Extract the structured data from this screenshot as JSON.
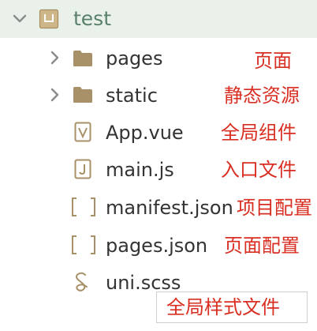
{
  "colors": {
    "header_bg": "#e9f1ea",
    "project_title": "#59806a",
    "annotation": "#d92e22",
    "icon": "#b19a6a",
    "chevron": "#8a8a8a",
    "text": "#333333"
  },
  "project": {
    "name": "test",
    "icon": "project-folder-icon",
    "expanded": true
  },
  "tree": [
    {
      "label": "pages",
      "icon": "folder-icon",
      "annotation": "页面"
    },
    {
      "label": "static",
      "icon": "folder-icon",
      "annotation": "静态资源"
    },
    {
      "label": "App.vue",
      "icon": "vue-file-icon",
      "annotation": "全局组件"
    },
    {
      "label": "main.js",
      "icon": "js-file-icon",
      "annotation": "入口文件"
    },
    {
      "label": "manifest.json",
      "icon": "json-file-icon",
      "annotation": "项目配置"
    },
    {
      "label": "pages.json",
      "icon": "json-file-icon",
      "annotation": "页面配置"
    },
    {
      "label": "uni.scss",
      "icon": "sass-file-icon",
      "annotation": "全局样式文件"
    }
  ]
}
